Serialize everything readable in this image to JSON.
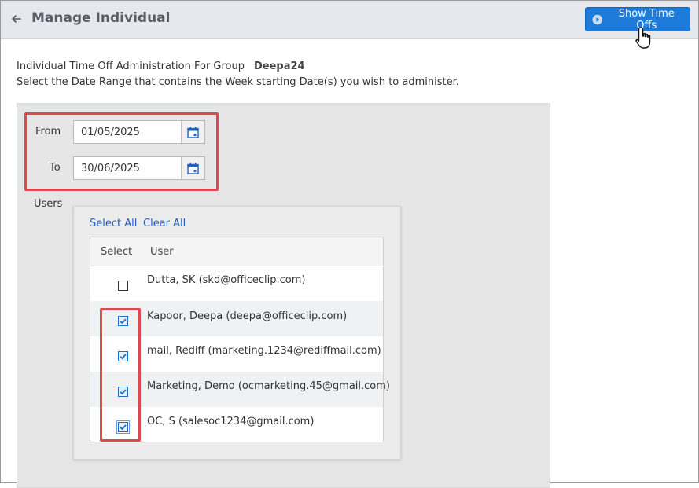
{
  "header": {
    "title": "Manage Individual",
    "show_button_label": "Show Time Offs"
  },
  "intro": {
    "line1_prefix": "Individual Time Off Administration For Group",
    "group_name": "Deepa24",
    "line2": "Select the Date Range that contains the Week starting Date(s) you wish to administer."
  },
  "date_range": {
    "from_label": "From",
    "from_value": "01/05/2025",
    "to_label": "To",
    "to_value": "30/06/2025"
  },
  "users": {
    "section_label": "Users",
    "select_all_label": "Select All",
    "clear_all_label": "Clear All",
    "columns": [
      "Select",
      "User"
    ],
    "rows": [
      {
        "user": "Dutta, SK (skd@officeclip.com)",
        "checked": false
      },
      {
        "user": "Kapoor, Deepa (deepa@officeclip.com)",
        "checked": true
      },
      {
        "user": "mail, Rediff (marketing.1234@rediffmail.com)",
        "checked": true
      },
      {
        "user": "Marketing, Demo (ocmarketing.45@gmail.com)",
        "checked": true
      },
      {
        "user": "OC, S (salesoc1234@gmail.com)",
        "checked": true
      }
    ]
  },
  "colors": {
    "accent": "#1e7bd9",
    "highlight": "#e0474c",
    "link": "#1f5fbf"
  }
}
